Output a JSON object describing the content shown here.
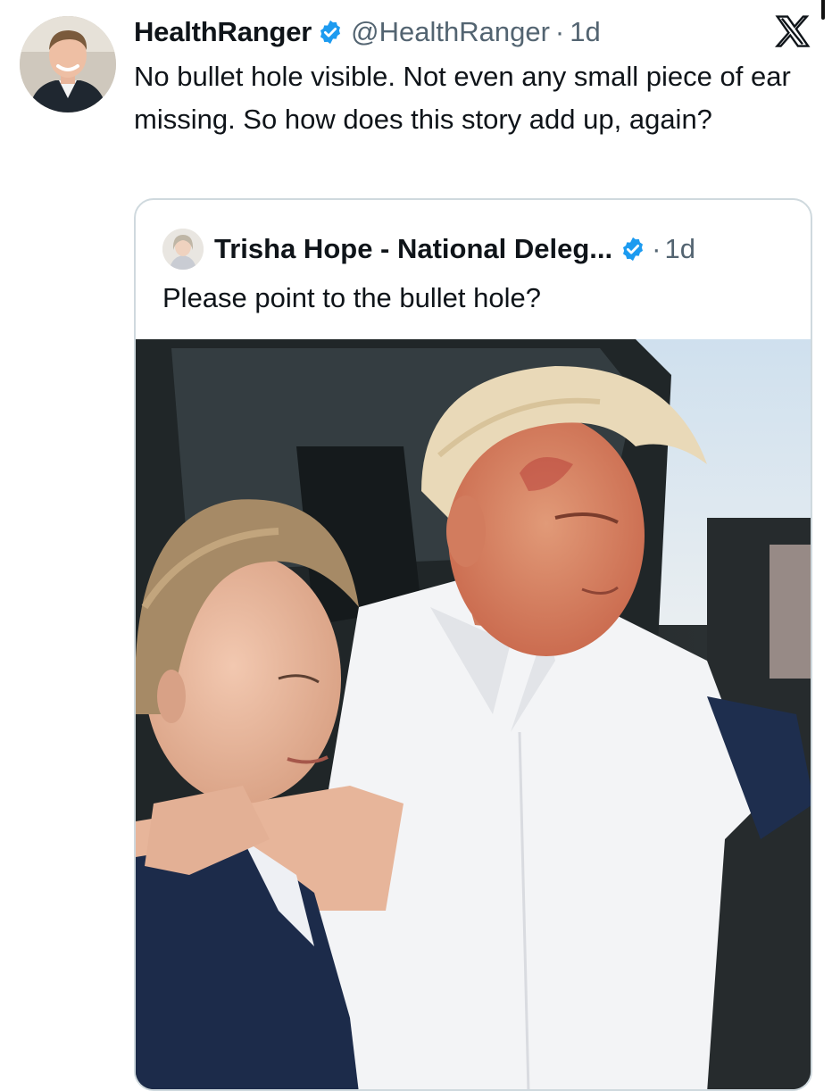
{
  "tweet": {
    "author": {
      "display_name": "HealthRanger",
      "handle": "@HealthRanger",
      "verified": true,
      "avatar_icon": "profile-photo"
    },
    "separator": "·",
    "timestamp": "1d",
    "text": "No bullet hole visible. Not even any small piece of ear missing. So how does this story add up, again?",
    "platform_icon": "x-logo-icon"
  },
  "quoted_tweet": {
    "author": {
      "display_name": "Trisha Hope - National Deleg...",
      "verified": true,
      "avatar_icon": "profile-photo"
    },
    "separator": "·",
    "timestamp": "1d",
    "text": "Please point to the bullet hole?",
    "media": {
      "type": "photo"
    }
  },
  "colors": {
    "verified_badge": "#1d9bf0",
    "secondary_text": "#536471",
    "border": "#cfd9de"
  }
}
